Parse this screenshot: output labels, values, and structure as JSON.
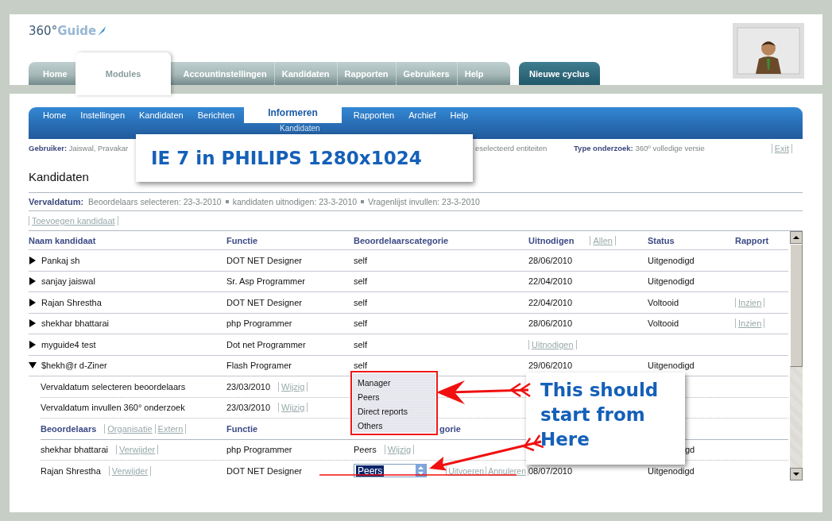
{
  "logo": {
    "number": "360°",
    "word": "Guide"
  },
  "top_tabs": [
    {
      "label": "Home",
      "selected": false
    },
    {
      "label": "Modules",
      "selected": true
    },
    {
      "label": "Accountinstellingen",
      "selected": false
    },
    {
      "label": "Kandidaten",
      "selected": false
    },
    {
      "label": "Rapporten",
      "selected": false
    },
    {
      "label": "Gebruikers",
      "selected": false
    },
    {
      "label": "Help",
      "selected": false
    }
  ],
  "action_tab": "Nieuwe cyclus",
  "nav": [
    {
      "label": "Home",
      "selected": false
    },
    {
      "label": "Instellingen",
      "selected": false
    },
    {
      "label": "Kandidaten",
      "selected": false
    },
    {
      "label": "Berichten",
      "selected": false
    },
    {
      "label": "Informeren",
      "selected": true
    },
    {
      "label": "Rapporten",
      "selected": false
    },
    {
      "label": "Archief",
      "selected": false
    },
    {
      "label": "Help",
      "selected": false
    }
  ],
  "subnav": "Kandidaten",
  "info": {
    "user_label": "Gebruiker:",
    "user_value": "Jaiswal, Pravakar",
    "fragment": "eselecteerd entiteiten",
    "type_label": "Type onderzoek:",
    "type_value": "360º volledige versie",
    "exit": "Exit"
  },
  "heading": "Kandidaten",
  "deadlines": {
    "label": "Vervaldatum:",
    "items": [
      "Beoordelaars selecteren: 23-3-2010",
      "kandidaten uitnodigen: 23-3-2010",
      "Vragenlijst invullen: 23-3-2010"
    ]
  },
  "add_link": "Toevoegen kandidaat",
  "table": {
    "columns": [
      "Naam kandidaat",
      "Functie",
      "Beoordelaarscategorie",
      "Uitnodigen",
      "Status",
      "Rapport"
    ],
    "invite_all": "Allen",
    "rows": [
      {
        "name": "Pankaj sh",
        "function": "DOT NET Designer",
        "category": "self",
        "invite": "28/06/2010",
        "status": "Uitgenodigd",
        "expanded": false
      },
      {
        "name": "sanjay jaiswal",
        "function": "Sr. Asp Programmer",
        "category": "self",
        "invite": "22/04/2010",
        "status": "Uitgenodigd",
        "expanded": false
      },
      {
        "name": "Rajan Shrestha",
        "function": "DOT NET Designer",
        "category": "self",
        "invite": "22/04/2010",
        "status": "Voltooid",
        "report": "Inzien",
        "expanded": false
      },
      {
        "name": "shekhar bhattarai",
        "function": "php Programmer",
        "category": "self",
        "invite": "28/06/2010",
        "status": "Voltooid",
        "report": "Inzien",
        "expanded": false
      },
      {
        "name": "myguide4 test",
        "function": "Dot net Programmer",
        "category": "self",
        "invite_link": "Uitnodigen",
        "expanded": false
      },
      {
        "name": "$hekh@r d-Ziner",
        "function": "Flash Programer",
        "category": "self",
        "invite": "29/06/2010",
        "status": "Uitgenodigd",
        "expanded": true
      }
    ]
  },
  "details": [
    {
      "label": "Vervaldatum selecteren beoordelaars",
      "date": "23/03/2010",
      "link": "Wijzig"
    },
    {
      "label": "Vervaldatum invullen 360° onderzoek",
      "date": "23/03/2010",
      "link": "Wijzig"
    }
  ],
  "reviewers_header": {
    "title": "Beoordelaars",
    "links": [
      "Organisatie",
      "Extern"
    ],
    "function": "Functie",
    "category_visible": "gorie"
  },
  "reviewers": [
    {
      "kind": "view",
      "name": "shekhar bhattarai",
      "action": "Verwijder",
      "function": "php Programmer",
      "category": "Peers",
      "links": [
        "Wijzig"
      ],
      "status": "gd"
    },
    {
      "kind": "edit",
      "name": "Rajan Shrestha",
      "action": "Verwijder",
      "function": "DOT NET Designer",
      "category": "Peers",
      "links": [
        "Uitvoeren",
        "Annuleren"
      ],
      "invite": "08/07/2010",
      "status": "Uitgenodigd"
    }
  ],
  "annotations": {
    "screen_note": "IE 7 in PHILIPS 1280x1024",
    "options": [
      "Manager",
      "Peers",
      "Direct reports",
      "Others"
    ],
    "note": "This should start from Here"
  }
}
